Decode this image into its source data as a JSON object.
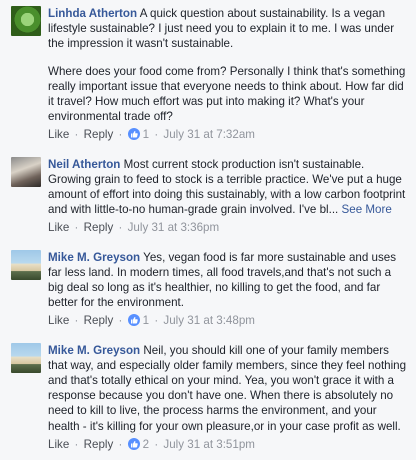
{
  "comments": [
    {
      "author": "Linhda Atherton",
      "paragraphs": [
        "A quick question about sustainability. Is a vegan lifestyle sustainable? I just need you to explain it to me. I was under the impression it wasn't sustainable.",
        "Where does your food come from? Personally I think that's something really important issue that everyone needs to think about. How far did it travel? How much effort was put into making it? What's your environmental trade off?"
      ],
      "like_label": "Like",
      "reply_label": "Reply",
      "reactions": "1",
      "timestamp": "July 31 at 7:32am"
    },
    {
      "author": "Neil Atherton",
      "paragraphs": [
        "Most current stock production isn't sustainable. Growing grain to feed to stock is a terrible practice. We've put a huge amount of effort into doing this sustainably, with a low carbon footprint and with little-to-no human-grade grain involved. I've bl..."
      ],
      "see_more": "See More",
      "like_label": "Like",
      "reply_label": "Reply",
      "timestamp": "July 31 at 3:36pm"
    },
    {
      "author": "Mike M. Greyson",
      "paragraphs": [
        "Yes, vegan food is far more sustainable and uses far less land. In modern times, all food travels,and that's not such a big deal so long as it's healthier, no killing to get the food, and far better for the environment."
      ],
      "like_label": "Like",
      "reply_label": "Reply",
      "reactions": "1",
      "timestamp": "July 31 at 3:48pm"
    },
    {
      "author": "Mike M. Greyson",
      "paragraphs": [
        "Neil, you should kill one of your family members that way, and especially older family members, since they feel nothing and that's totally ethical on your mind. Yea, you won't grace it with a response because you don't have one. When there is absolutely no need to kill to live, the process harms the environment, and your health - it's killing for your own pleasure,or in your case profit as well."
      ],
      "like_label": "Like",
      "reply_label": "Reply",
      "reactions": "2",
      "timestamp": "July 31 at 3:51pm"
    }
  ],
  "separator": "·",
  "icons": {
    "like_badge": "thumbs-up-icon",
    "avatar_1": "avatar-green-leaf",
    "avatar_2": "avatar-photo",
    "avatar_3": "avatar-beach",
    "avatar_4": "avatar-beach"
  },
  "colors": {
    "background": "#f6f7f9",
    "name": "#365899",
    "text": "#1d2129",
    "meta": "#90949c",
    "like_badge": "#5890ff"
  }
}
